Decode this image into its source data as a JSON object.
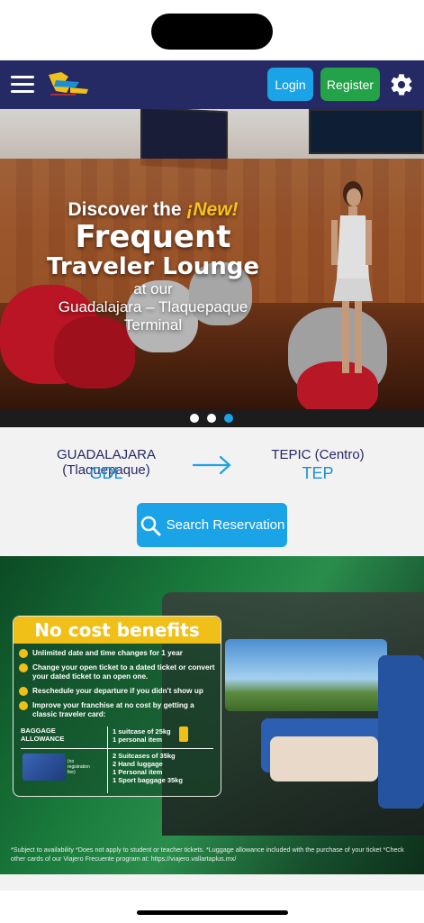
{
  "header": {
    "login_label": "Login",
    "register_label": "Register",
    "icons": [
      "menu-icon",
      "brand-logo",
      "gear-icon"
    ],
    "colors": {
      "nav_bg": "#262a64",
      "login": "#1aa3e6",
      "register": "#23a24a"
    }
  },
  "hero": {
    "line1_prefix": "Discover the ",
    "line1_new": "¡New!",
    "line2": "Frequent",
    "line3": "Traveler Lounge",
    "line4": "at our",
    "line5": "Guadalajara – Tlaquepaque",
    "line6": "Terminal",
    "slides_total": 3,
    "active_slide": 3
  },
  "route": {
    "origin_name": "GUADALAJARA (Tlaquepaque)",
    "origin_code": "GDL",
    "destination_name": "TEPIC (Centro)",
    "destination_code": "TEP",
    "search_label": "Search Reservation"
  },
  "promo": {
    "title": "No cost benefits",
    "benefits": [
      "Unlimited date and time changes for 1 year",
      "Change your open ticket to a dated ticket or convert your dated ticket to an open one.",
      "Reschedule your departure if you didn't show up",
      "Improve your franchise at no cost by getting a classic traveler card:"
    ],
    "baggage_label_1": "BAGGAGE",
    "baggage_label_2": "ALLOWANCE",
    "standard_1": "1 suitcase of 25kg",
    "standard_2": "1 personal item",
    "card_1": "2 Suitcases of 35kg",
    "card_2": "2 Hand luggage",
    "card_3": "1 Personal item",
    "card_4": "1 Sport baggage 35kg",
    "no_fee_1": "(no",
    "no_fee_2": "registration",
    "no_fee_3": "fee)",
    "footnote": "*Subject to availability *Does not apply to student or teacher tickets. *Luggage allowance included with the purchase of your ticket *Check other cards of our Viajero Frecuente program at: https://viajero.vallartaplus.mx/"
  }
}
